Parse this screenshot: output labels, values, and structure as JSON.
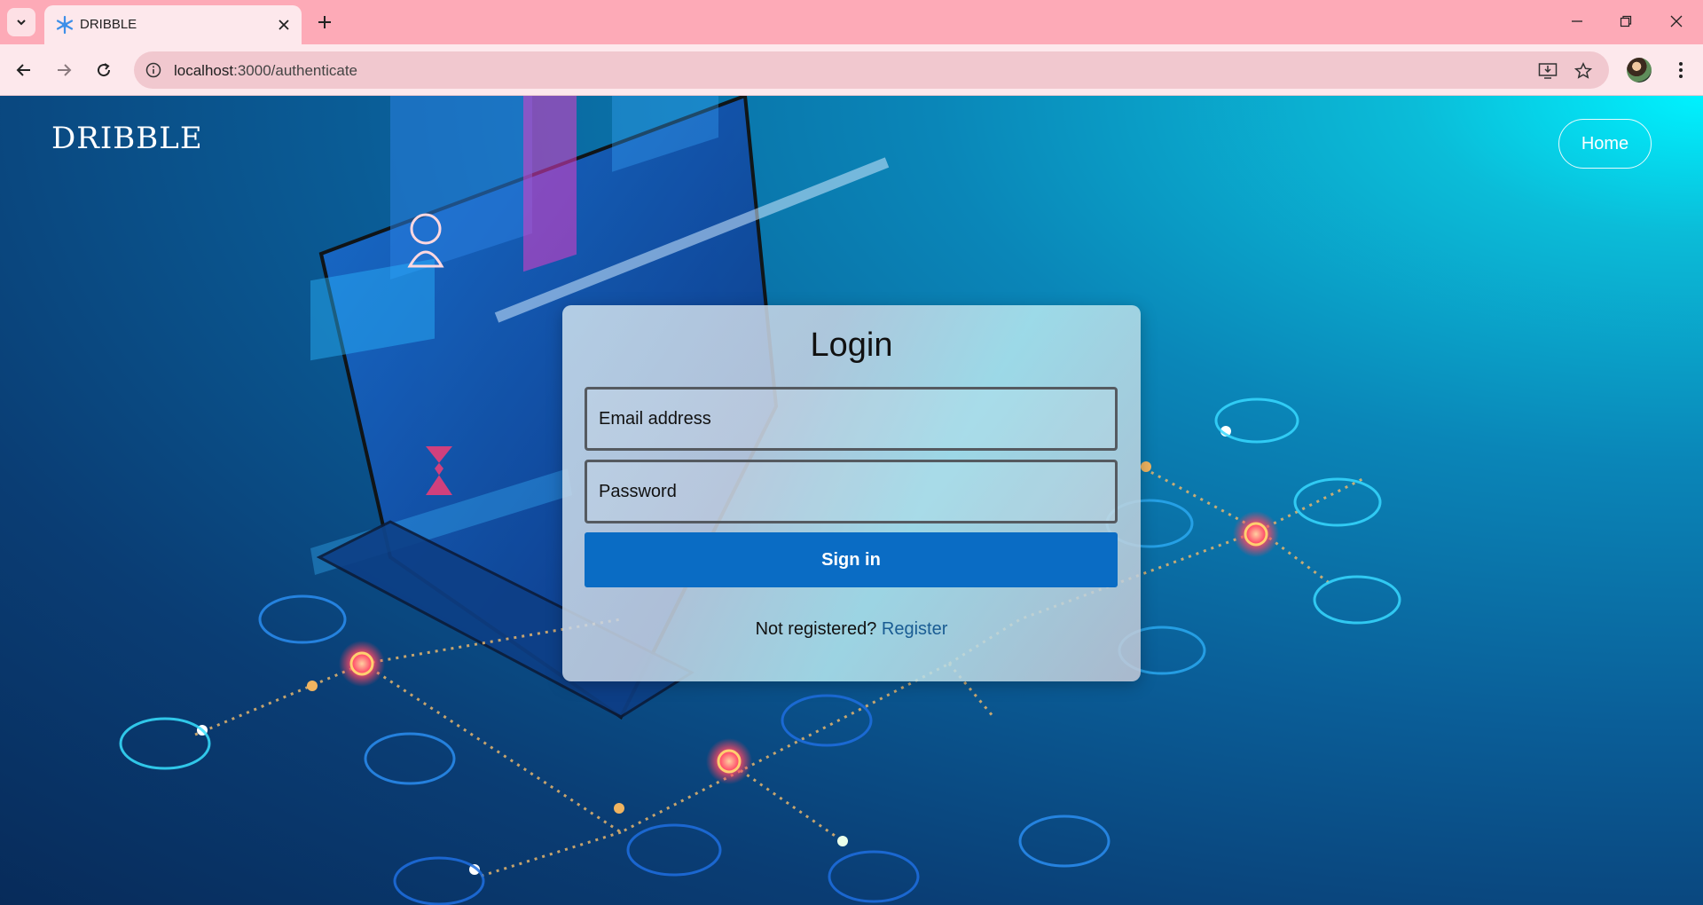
{
  "browser": {
    "tab_title": "DRIBBLE",
    "url_host": "localhost",
    "url_rest": ":3000/authenticate"
  },
  "header": {
    "brand": "DRIBBLE",
    "home_label": "Home"
  },
  "login": {
    "title": "Login",
    "email_placeholder": "Email address",
    "password_placeholder": "Password",
    "submit_label": "Sign in",
    "register_prompt": "Not registered?",
    "register_link": "Register"
  },
  "colors": {
    "tabbar": "#fdaab7",
    "toolbar": "#fde8ec",
    "primary_button": "#0a6cc4",
    "link": "#1a5c93"
  }
}
